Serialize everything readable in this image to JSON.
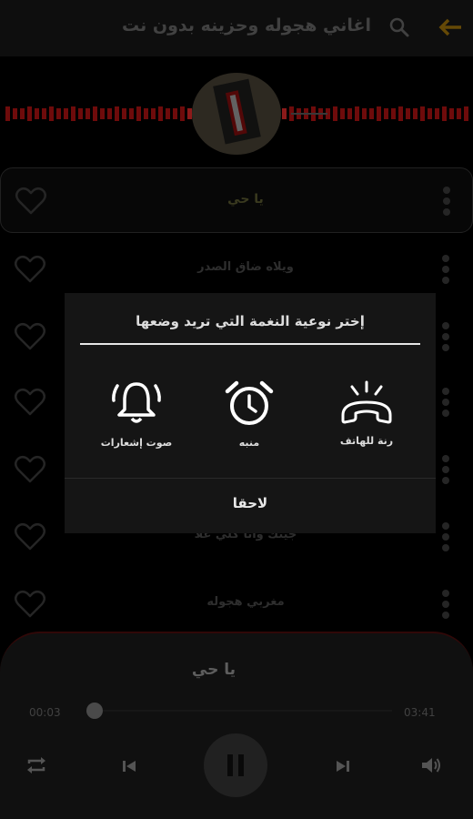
{
  "app": {
    "title": "اغاني هجوله وحزينه بدون نت"
  },
  "songs": [
    {
      "title": "يا حي",
      "active": true
    },
    {
      "title": "ويلاه ضاق الصدر"
    },
    {
      "title": ""
    },
    {
      "title": ""
    },
    {
      "title": ""
    },
    {
      "title": "جيتك وانا كلي غلا"
    },
    {
      "title": "مغربي هجوله"
    }
  ],
  "dialog": {
    "title": "إختر نوعية النغمة التي تريد وضعها",
    "options": {
      "ringtone": "رنة للهاتف",
      "alarm": "منبه",
      "notification": "صوت إشعارات"
    },
    "later": "لاحقا"
  },
  "player": {
    "song": "يا حي",
    "current_time": "00:03",
    "duration": "03:41",
    "progress": 0.014
  },
  "colors": {
    "accent_red": "#c81414",
    "back_arrow": "#b8860b",
    "background": "#000000"
  },
  "icons": [
    "back-arrow-icon",
    "search-icon",
    "heart-icon",
    "more-vert-icon",
    "phone-ringing-icon",
    "alarm-clock-icon",
    "bell-icon",
    "repeat-icon",
    "skip-previous-icon",
    "pause-icon",
    "skip-next-icon",
    "volume-icon"
  ]
}
